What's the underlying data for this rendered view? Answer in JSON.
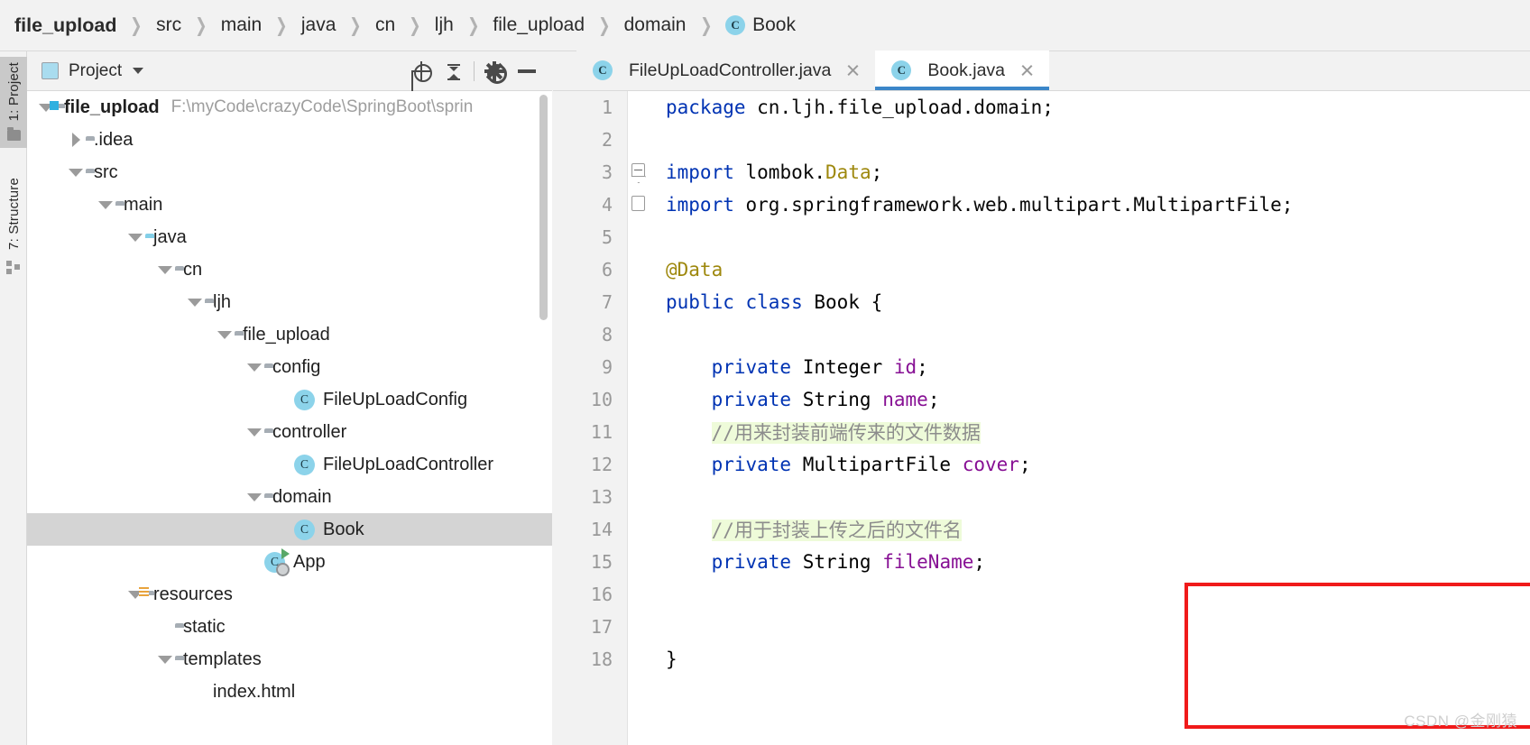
{
  "breadcrumb": {
    "items": [
      {
        "label": "file_upload",
        "bold": true
      },
      {
        "label": "src"
      },
      {
        "label": "main"
      },
      {
        "label": "java"
      },
      {
        "label": "cn"
      },
      {
        "label": "ljh"
      },
      {
        "label": "file_upload"
      },
      {
        "label": "domain"
      },
      {
        "label": "Book",
        "icon": "class-icon",
        "badge": "C"
      }
    ],
    "separator": "❯"
  },
  "toolstrip": {
    "tabs": [
      {
        "label": "1: Project",
        "icon": "folder-icon",
        "active": true
      },
      {
        "label": "7: Structure",
        "icon": "structure-grid-icon",
        "active": false
      }
    ]
  },
  "project_panel": {
    "title": "Project",
    "caret": "chevron-down-icon",
    "actions": [
      {
        "name": "locate-icon",
        "label": "Select Opened File"
      },
      {
        "name": "collapse-all-icon",
        "label": "Collapse All"
      },
      {
        "name": "gear-icon",
        "label": "Settings"
      },
      {
        "name": "minimize-icon",
        "label": "Hide"
      }
    ],
    "tree": [
      {
        "indent": 0,
        "twisty": "down",
        "icon": "module-folder-icon",
        "label": "file_upload",
        "bold": true,
        "path": "F:\\myCode\\crazyCode\\SpringBoot\\sprin"
      },
      {
        "indent": 1,
        "twisty": "right",
        "icon": "folder-icon",
        "label": ".idea"
      },
      {
        "indent": 1,
        "twisty": "down",
        "icon": "folder-icon",
        "label": "src"
      },
      {
        "indent": 2,
        "twisty": "down",
        "icon": "folder-icon",
        "label": "main"
      },
      {
        "indent": 3,
        "twisty": "down",
        "icon": "source-folder-icon",
        "label": "java"
      },
      {
        "indent": 4,
        "twisty": "down",
        "icon": "package-icon",
        "label": "cn"
      },
      {
        "indent": 5,
        "twisty": "down",
        "icon": "package-icon",
        "label": "ljh"
      },
      {
        "indent": 6,
        "twisty": "down",
        "icon": "package-icon",
        "label": "file_upload"
      },
      {
        "indent": 7,
        "twisty": "down",
        "icon": "package-icon",
        "label": "config"
      },
      {
        "indent": 8,
        "twisty": "none",
        "icon": "class-icon",
        "label": "FileUpLoadConfig"
      },
      {
        "indent": 7,
        "twisty": "down",
        "icon": "package-icon",
        "label": "controller"
      },
      {
        "indent": 8,
        "twisty": "none",
        "icon": "class-icon",
        "label": "FileUpLoadController"
      },
      {
        "indent": 7,
        "twisty": "down",
        "icon": "package-icon",
        "label": "domain"
      },
      {
        "indent": 8,
        "twisty": "none",
        "icon": "class-icon",
        "label": "Book",
        "selected": true
      },
      {
        "indent": 7,
        "twisty": "none",
        "icon": "runnable-class-icon",
        "label": "App"
      },
      {
        "indent": 3,
        "twisty": "down",
        "icon": "resources-folder-icon",
        "label": "resources"
      },
      {
        "indent": 4,
        "twisty": "none",
        "icon": "folder-icon",
        "label": "static"
      },
      {
        "indent": 4,
        "twisty": "down",
        "icon": "folder-icon",
        "label": "templates"
      },
      {
        "indent": 5,
        "twisty": "none",
        "icon": "html-file-icon",
        "label": "index.html"
      }
    ]
  },
  "editor": {
    "tabs": [
      {
        "label": "FileUpLoadController.java",
        "icon": "class-icon",
        "badge": "C",
        "active": false,
        "closable": true
      },
      {
        "label": "Book.java",
        "icon": "class-icon",
        "badge": "C",
        "active": true,
        "closable": true
      }
    ],
    "lines": [
      {
        "num": "1",
        "fold": "none",
        "tokens": [
          {
            "t": "package ",
            "c": "kw"
          },
          {
            "t": "cn.ljh.file_upload.domain;",
            "c": "plain"
          }
        ]
      },
      {
        "num": "2",
        "fold": "none",
        "tokens": []
      },
      {
        "num": "3",
        "fold": "minus",
        "tokens": [
          {
            "t": "import ",
            "c": "kw"
          },
          {
            "t": "lombok.",
            "c": "plain"
          },
          {
            "t": "Data",
            "c": "anno"
          },
          {
            "t": ";",
            "c": "plain"
          }
        ]
      },
      {
        "num": "4",
        "fold": "plain",
        "tokens": [
          {
            "t": "import ",
            "c": "kw"
          },
          {
            "t": "org.springframework.web.multipart.MultipartFile;",
            "c": "plain"
          }
        ]
      },
      {
        "num": "5",
        "fold": "none",
        "tokens": []
      },
      {
        "num": "6",
        "fold": "none",
        "tokens": [
          {
            "t": "@Data",
            "c": "anno"
          }
        ]
      },
      {
        "num": "7",
        "fold": "none",
        "tokens": [
          {
            "t": "public class ",
            "c": "kw"
          },
          {
            "t": "Book ",
            "c": "cls"
          },
          {
            "t": "{",
            "c": "plain"
          }
        ]
      },
      {
        "num": "8",
        "fold": "none",
        "tokens": []
      },
      {
        "num": "9",
        "fold": "none",
        "tokens": [
          {
            "t": "    private ",
            "c": "kw"
          },
          {
            "t": "Integer ",
            "c": "cls"
          },
          {
            "t": "id",
            "c": "fld"
          },
          {
            "t": ";",
            "c": "plain"
          }
        ]
      },
      {
        "num": "10",
        "fold": "none",
        "tokens": [
          {
            "t": "    private ",
            "c": "kw"
          },
          {
            "t": "String ",
            "c": "cls"
          },
          {
            "t": "name",
            "c": "fld"
          },
          {
            "t": ";",
            "c": "plain"
          }
        ]
      },
      {
        "num": "11",
        "fold": "none",
        "tokens": [
          {
            "t": "    ",
            "c": "plain"
          },
          {
            "t": "//用来封装前端传来的文件数据",
            "c": "cmt"
          }
        ]
      },
      {
        "num": "12",
        "fold": "none",
        "tokens": [
          {
            "t": "    private ",
            "c": "kw"
          },
          {
            "t": "MultipartFile ",
            "c": "cls"
          },
          {
            "t": "cover",
            "c": "fld"
          },
          {
            "t": ";",
            "c": "plain"
          }
        ]
      },
      {
        "num": "13",
        "fold": "none",
        "tokens": []
      },
      {
        "num": "14",
        "fold": "none",
        "tokens": [
          {
            "t": "    ",
            "c": "plain"
          },
          {
            "t": "//用于封装上传之后的文件名",
            "c": "cmt"
          }
        ]
      },
      {
        "num": "15",
        "fold": "none",
        "tokens": [
          {
            "t": "    private ",
            "c": "kw"
          },
          {
            "t": "String ",
            "c": "cls"
          },
          {
            "t": "fileName",
            "c": "fld"
          },
          {
            "t": ";",
            "c": "plain"
          }
        ]
      },
      {
        "num": "16",
        "fold": "none",
        "tokens": []
      },
      {
        "num": "17",
        "fold": "none",
        "tokens": []
      },
      {
        "num": "18",
        "fold": "none",
        "tokens": [
          {
            "t": "}",
            "c": "plain"
          }
        ]
      }
    ]
  },
  "annotation": {
    "type": "red-rectangle",
    "color": "#f01a1a"
  },
  "watermark": {
    "text": "CSDN @金刚猿"
  }
}
